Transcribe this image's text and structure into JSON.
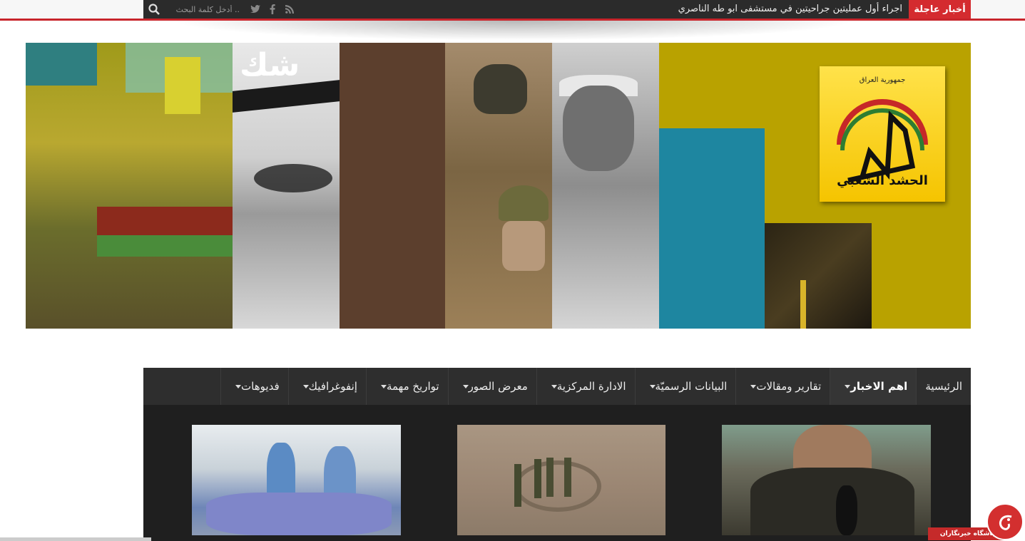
{
  "topbar": {
    "search_placeholder": "أدخل كلمة البحث ..",
    "breaking_label": "أخبار عاجلة",
    "breaking_text": "اجراء أول عمليتين جراحيتين في مستشفى ابو طه الناصري",
    "social_icons": [
      "rss-icon",
      "facebook-icon",
      "twitter-icon"
    ]
  },
  "banner": {
    "logo_text": "الحشد الشعبي",
    "logo_arc_text": "جمهورية العراق",
    "overlay_text": "شك"
  },
  "nav": {
    "items": [
      {
        "label": "الرئيسية",
        "dropdown": false,
        "active": false
      },
      {
        "label": "اهم الاخبار",
        "dropdown": true,
        "active": true
      },
      {
        "label": "تقارير ومقالات",
        "dropdown": true,
        "active": false
      },
      {
        "label": "البيانات الرسميّة",
        "dropdown": true,
        "active": false
      },
      {
        "label": "الادارة المركزية",
        "dropdown": true,
        "active": false
      },
      {
        "label": "معرض الصور",
        "dropdown": true,
        "active": false
      },
      {
        "label": "تواريخ مهمة",
        "dropdown": true,
        "active": false
      },
      {
        "label": "إنفوغرافيك",
        "dropdown": true,
        "active": false
      },
      {
        "label": "فديوهات",
        "dropdown": true,
        "active": false
      }
    ]
  },
  "watermark": {
    "label": "باشگاه خبرنگاران"
  },
  "colors": {
    "accent": "#d42b2f",
    "nav_bg": "#2e2e2e",
    "banner_gold": "#b9a200"
  }
}
